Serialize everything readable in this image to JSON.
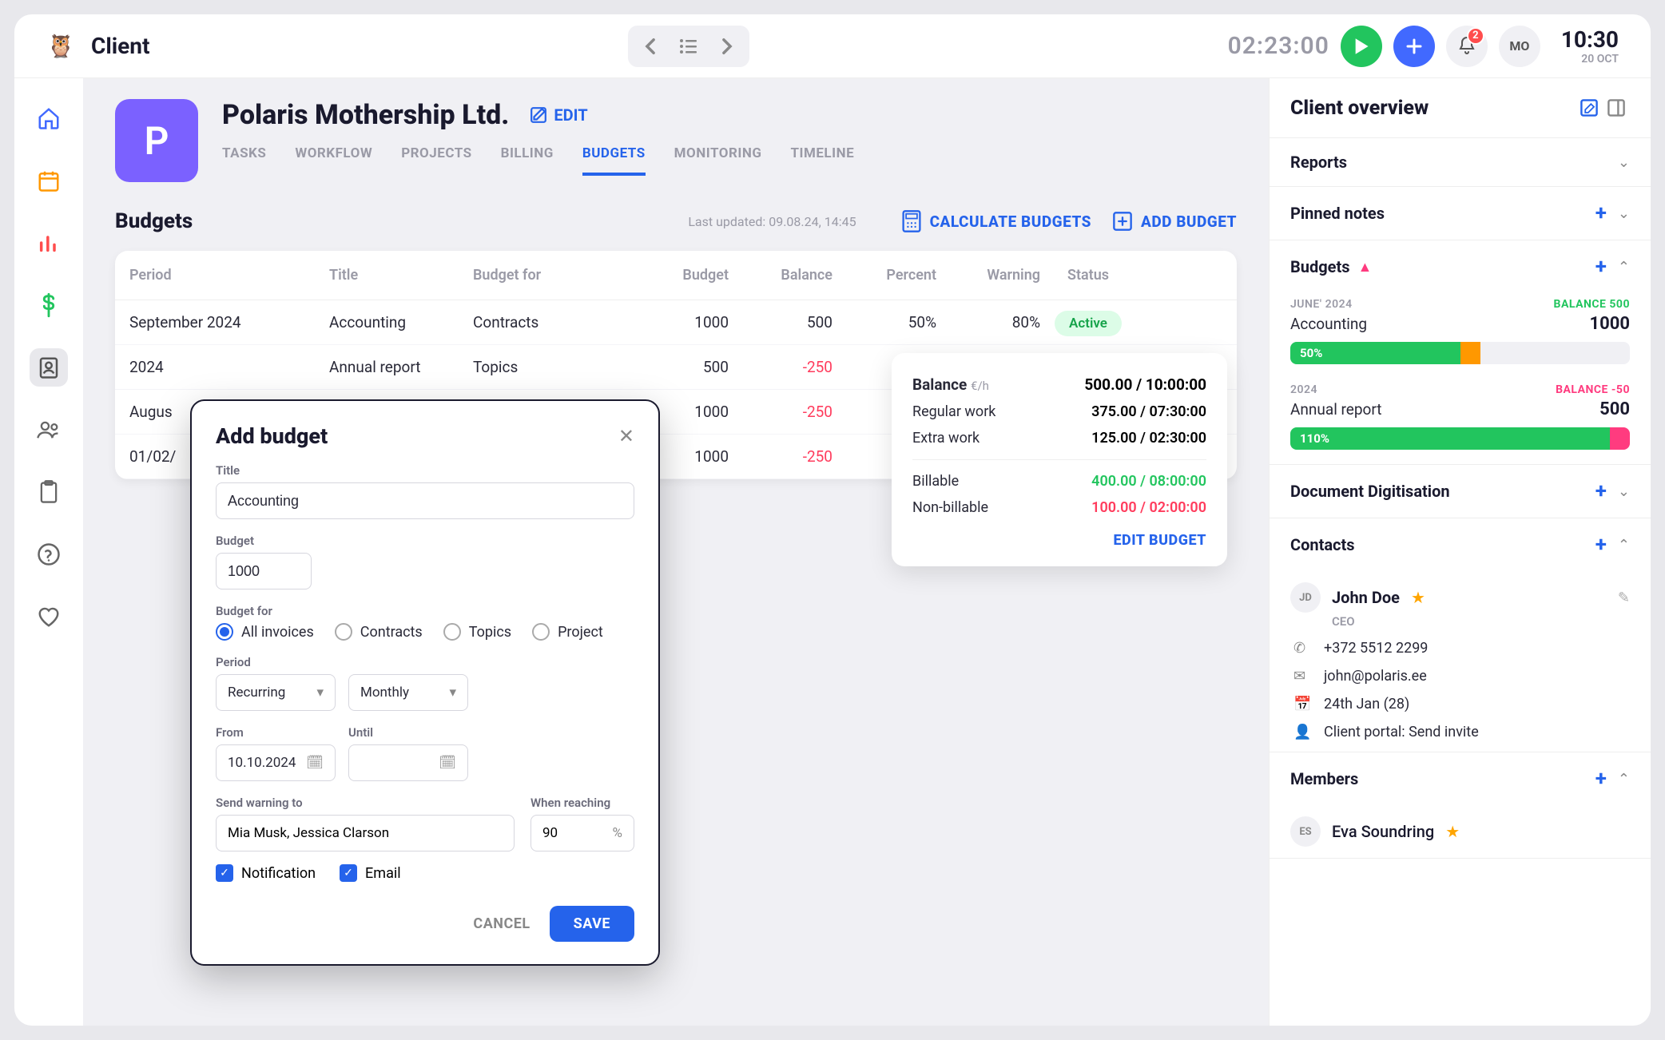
{
  "topbar": {
    "page_title": "Client",
    "timer": "02:23:00",
    "notification_count": "2",
    "user_initials": "MO",
    "clock_time": "10:30",
    "clock_date": "20 OCT"
  },
  "client": {
    "avatar_letter": "P",
    "name": "Polaris Mothership Ltd.",
    "edit_label": "EDIT",
    "tabs": [
      "TASKS",
      "WORKFLOW",
      "PROJECTS",
      "BILLING",
      "BUDGETS",
      "MONITORING",
      "TIMELINE"
    ],
    "active_tab": "BUDGETS"
  },
  "budgets": {
    "title": "Budgets",
    "updated": "Last updated: 09.08.24, 14:45",
    "calc_label": "CALCULATE BUDGETS",
    "add_label": "ADD BUDGET",
    "headers": {
      "period": "Period",
      "title": "Title",
      "for": "Budget for",
      "budget": "Budget",
      "balance": "Balance",
      "percent": "Percent",
      "warning": "Warning",
      "status": "Status"
    },
    "rows": [
      {
        "period": "September 2024",
        "title": "Accounting",
        "for": "Contracts",
        "budget": "1000",
        "balance": "500",
        "percent": "50%",
        "warning": "80%",
        "status": "Active",
        "neg": false
      },
      {
        "period": "2024",
        "title": "Annual report",
        "for": "Topics",
        "budget": "500",
        "balance": "-250",
        "percent": "",
        "warning": "",
        "status": "",
        "neg": true
      },
      {
        "period": "Augus",
        "title": "",
        "for": "",
        "budget": "1000",
        "balance": "-250",
        "percent": "",
        "warning": "",
        "status": "",
        "neg": true
      },
      {
        "period": "01/02/",
        "title": "",
        "for": "",
        "budget": "1000",
        "balance": "-250",
        "percent": "",
        "warning": "",
        "status": "",
        "neg": true
      }
    ]
  },
  "popover": {
    "title_label": "Balance",
    "title_unit": "€/h",
    "title_value": "500.00 / 10:00:00",
    "rows": [
      {
        "label": "Regular work",
        "value": "375.00 / 07:30:00"
      },
      {
        "label": "Extra work",
        "value": "125.00 / 02:30:00"
      }
    ],
    "billable_label": "Billable",
    "billable_value": "400.00 / 08:00:00",
    "nonbillable_label": "Non-billable",
    "nonbillable_value": "100.00 / 02:00:00",
    "edit_label": "EDIT BUDGET"
  },
  "rightpanel": {
    "overview_title": "Client overview",
    "reports": "Reports",
    "pinned_notes": "Pinned notes",
    "budgets_title": "Budgets",
    "budget_cards": [
      {
        "date": "JUNE' 2024",
        "balance_label": "BALANCE 500",
        "name": "Accounting",
        "amount": "1000",
        "pct": "50%",
        "fill": 50,
        "warn_start": 50,
        "warn_end": 56,
        "neg": false
      },
      {
        "date": "2024",
        "balance_label": "BALANCE -50",
        "name": "Annual report",
        "amount": "500",
        "pct": "110%",
        "fill": 94,
        "over": 6,
        "neg": true
      }
    ],
    "doc_dig": "Document Digitisation",
    "contacts_title": "Contacts",
    "contact": {
      "initials": "JD",
      "name": "John Doe",
      "role": "CEO",
      "phone": "+372 5512 2299",
      "email": "john@polaris.ee",
      "bday": "24th Jan (28)",
      "portal": "Client portal: Send invite"
    },
    "members_title": "Members",
    "member": {
      "initials": "ES",
      "name": "Eva Soundring"
    }
  },
  "modal": {
    "title": "Add budget",
    "title_label": "Title",
    "title_value": "Accounting",
    "budget_label": "Budget",
    "budget_value": "1000",
    "budget_for_label": "Budget for",
    "options": [
      "All invoices",
      "Contracts",
      "Topics",
      "Project"
    ],
    "selected_option": "All invoices",
    "period_label": "Period",
    "period_value": "Recurring",
    "freq_value": "Monthly",
    "from_label": "From",
    "from_value": "10.10.2024",
    "until_label": "Until",
    "until_value": "",
    "warning_to_label": "Send warning to",
    "warning_to_value": "Mia Musk, Jessica Clarson",
    "reaching_label": "When reaching",
    "reaching_value": "90",
    "reaching_unit": "%",
    "notification_label": "Notification",
    "email_label": "Email",
    "cancel": "CANCEL",
    "save": "SAVE"
  }
}
